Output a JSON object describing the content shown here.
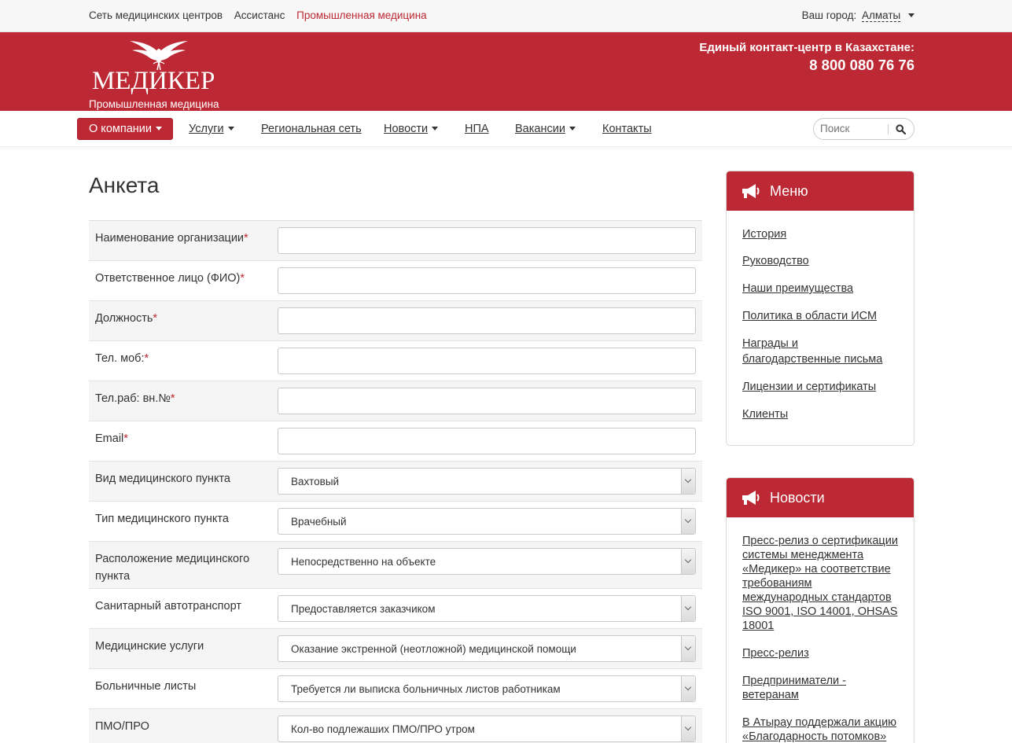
{
  "topbar": {
    "links": [
      {
        "label": "Сеть медицинских центров",
        "active": false
      },
      {
        "label": "Ассистанс",
        "active": false
      },
      {
        "label": "Промышленная медицина",
        "active": true
      }
    ],
    "city_label": "Ваш город:",
    "city": "Алматы"
  },
  "header": {
    "logo_name": "МЕДИКЕР",
    "logo_sub": "Промышленная медицина",
    "contact_label": "Единый контакт-центр в Казахстане:",
    "phone": "8 800 080 76 76"
  },
  "nav": {
    "items": [
      {
        "label": "О компании",
        "dropdown": true,
        "active": true
      },
      {
        "label": "Услуги",
        "dropdown": true
      },
      {
        "label": "Региональная сеть",
        "dropdown": false
      },
      {
        "label": "Новости",
        "dropdown": true
      },
      {
        "label": "НПА",
        "dropdown": false
      },
      {
        "label": "Вакансии",
        "dropdown": true
      },
      {
        "label": "Контакты",
        "dropdown": false
      }
    ],
    "search_placeholder": "Поиск"
  },
  "page": {
    "title": "Анкета"
  },
  "form": {
    "rows": [
      {
        "label": "Наименование организации",
        "required": true,
        "type": "text",
        "value": ""
      },
      {
        "label": "Ответственное лицо (ФИО)",
        "required": true,
        "type": "text",
        "value": ""
      },
      {
        "label": "Должность",
        "required": true,
        "type": "text",
        "value": ""
      },
      {
        "label": "Тел. моб:",
        "required": true,
        "type": "text",
        "value": ""
      },
      {
        "label": "Тел.раб: вн.№",
        "required": true,
        "type": "text",
        "value": ""
      },
      {
        "label": "Email",
        "required": true,
        "type": "text",
        "value": ""
      },
      {
        "label": "Вид медицинского пункта",
        "required": false,
        "type": "select",
        "value": "Вахтовый"
      },
      {
        "label": "Тип медицинского пункта",
        "required": false,
        "type": "select",
        "value": "Врачебный"
      },
      {
        "label": "Расположение медицинского пункта",
        "required": false,
        "type": "select",
        "value": "Непосредственно на объекте"
      },
      {
        "label": "Санитарный автотранспорт",
        "required": false,
        "type": "select",
        "value": "Предоставляется заказчиком"
      },
      {
        "label": "Медицинские услуги",
        "required": false,
        "type": "select",
        "value": "Оказание экстренной (неотложной) медицинской помощи"
      },
      {
        "label": "Больничные листы",
        "required": false,
        "type": "select",
        "value": "Требуется ли выписка больничных листов работникам"
      },
      {
        "label": "ПМО/ПРО",
        "required": false,
        "type": "select",
        "value": "Кол-во подлежаших ПМО/ПРО утром"
      }
    ]
  },
  "sidebar": {
    "menu": {
      "title": "Меню",
      "icon": "megaphone-icon",
      "items": [
        "История",
        "Руководство",
        "Наши преимущества",
        "Политика в области ИСМ",
        "Награды и благодарственные письма",
        "Лицензии и сертификаты",
        "Клиенты"
      ]
    },
    "news": {
      "title": "Новости",
      "icon": "megaphone-icon",
      "items": [
        "Пресс-релиз о сертификации системы менеджмента «Медикер» на соответствие требованиям международных стандартов ISO 9001, ISO 14001, OHSAS 18001",
        "Пресс-релиз",
        "Предприниматели - ветеранам",
        "В Атырау поддержали акцию «Благодарность потомков»"
      ]
    }
  },
  "colors": {
    "brand": "#bc2833",
    "required": "#bc2833"
  }
}
